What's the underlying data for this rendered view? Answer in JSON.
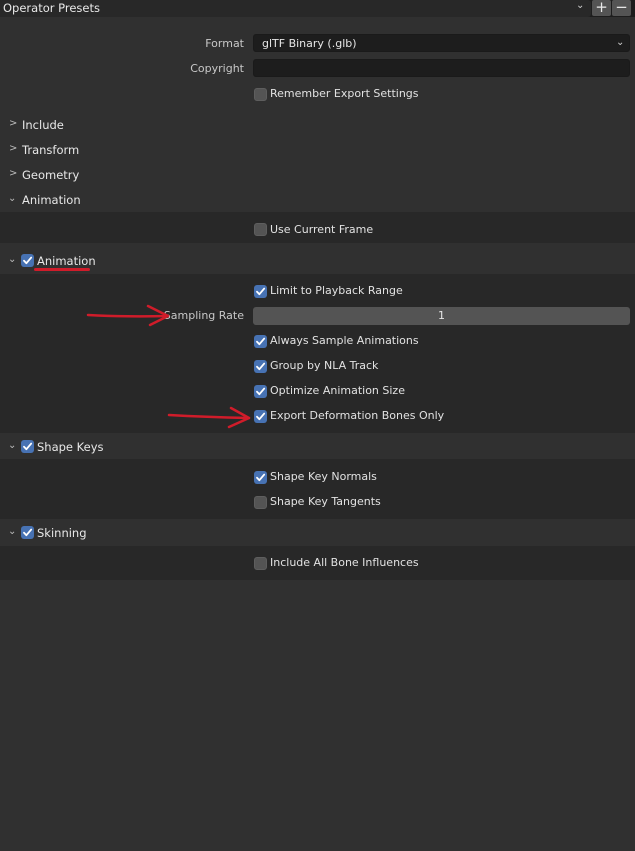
{
  "presets": {
    "title": "Operator Presets",
    "add_label": "+",
    "remove_label": "−"
  },
  "format": {
    "label": "Format",
    "value": "glTF Binary (.glb)"
  },
  "copyright": {
    "label": "Copyright",
    "value": ""
  },
  "remember": {
    "label": "Remember Export Settings",
    "checked": false
  },
  "sections": {
    "include": "Include",
    "transform": "Transform",
    "geometry": "Geometry",
    "animation": "Animation"
  },
  "animation": {
    "use_current_frame": {
      "label": "Use Current Frame",
      "checked": false
    },
    "sub": {
      "title": "Animation",
      "checked": true,
      "limit_playback": {
        "label": "Limit to Playback Range",
        "checked": true
      },
      "sampling_rate": {
        "label": "Sampling Rate",
        "value": "1"
      },
      "always_sample": {
        "label": "Always Sample Animations",
        "checked": true
      },
      "group_nla": {
        "label": "Group by NLA Track",
        "checked": true
      },
      "optimize_size": {
        "label": "Optimize Animation Size",
        "checked": true
      },
      "export_deform": {
        "label": "Export Deformation Bones Only",
        "checked": true
      }
    }
  },
  "shape_keys": {
    "title": "Shape Keys",
    "checked": true,
    "normals": {
      "label": "Shape Key Normals",
      "checked": true
    },
    "tangents": {
      "label": "Shape Key Tangents",
      "checked": false
    }
  },
  "skinning": {
    "title": "Skinning",
    "checked": true,
    "all_influences": {
      "label": "Include All Bone Influences",
      "checked": false
    }
  },
  "colors": {
    "accent": "#4772b3",
    "annotation": "#d01c2a"
  }
}
